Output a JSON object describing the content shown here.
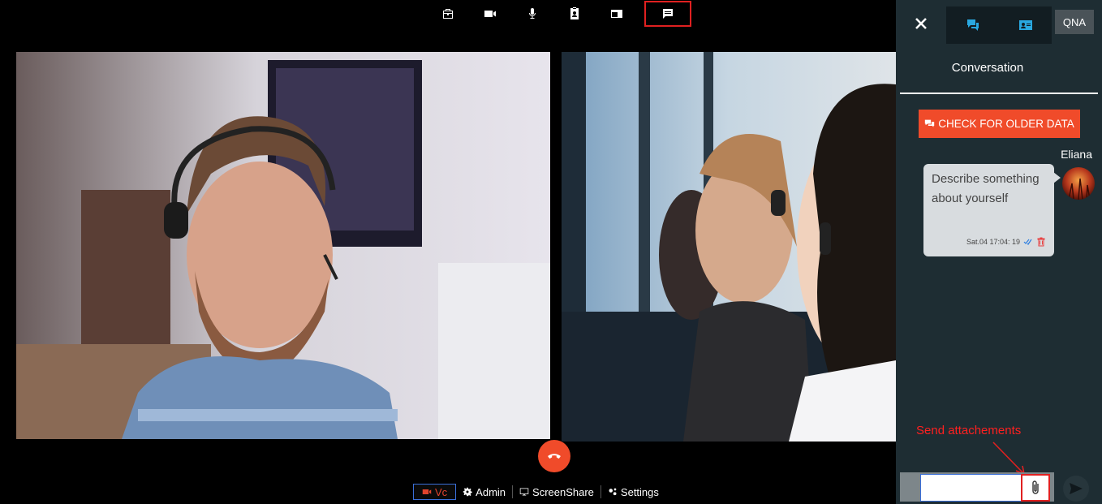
{
  "toolbar": {
    "icons": [
      "briefcase-icon",
      "video-camera-icon",
      "microphone-icon",
      "contact-card-icon",
      "picture-in-picture-icon",
      "chat-icon"
    ]
  },
  "bottom_bar": {
    "vc_label": "Vc",
    "admin_label": "Admin",
    "screenshare_label": "ScreenShare",
    "settings_label": "Settings"
  },
  "panel": {
    "qna_label": "QNA",
    "title": "Conversation",
    "older_button_label": "CHECK FOR OLDER DATA",
    "message": {
      "sender": "Eliana",
      "text": "Describe something about yourself",
      "timestamp": "Sat.04 17:04: 19"
    },
    "annotation": "Send attachements",
    "input_value": ""
  },
  "colors": {
    "accent": "#f04b2a",
    "panel_bg": "#1e2d33",
    "tab_icon": "#29a8e0",
    "annotation": "#ff2020"
  }
}
